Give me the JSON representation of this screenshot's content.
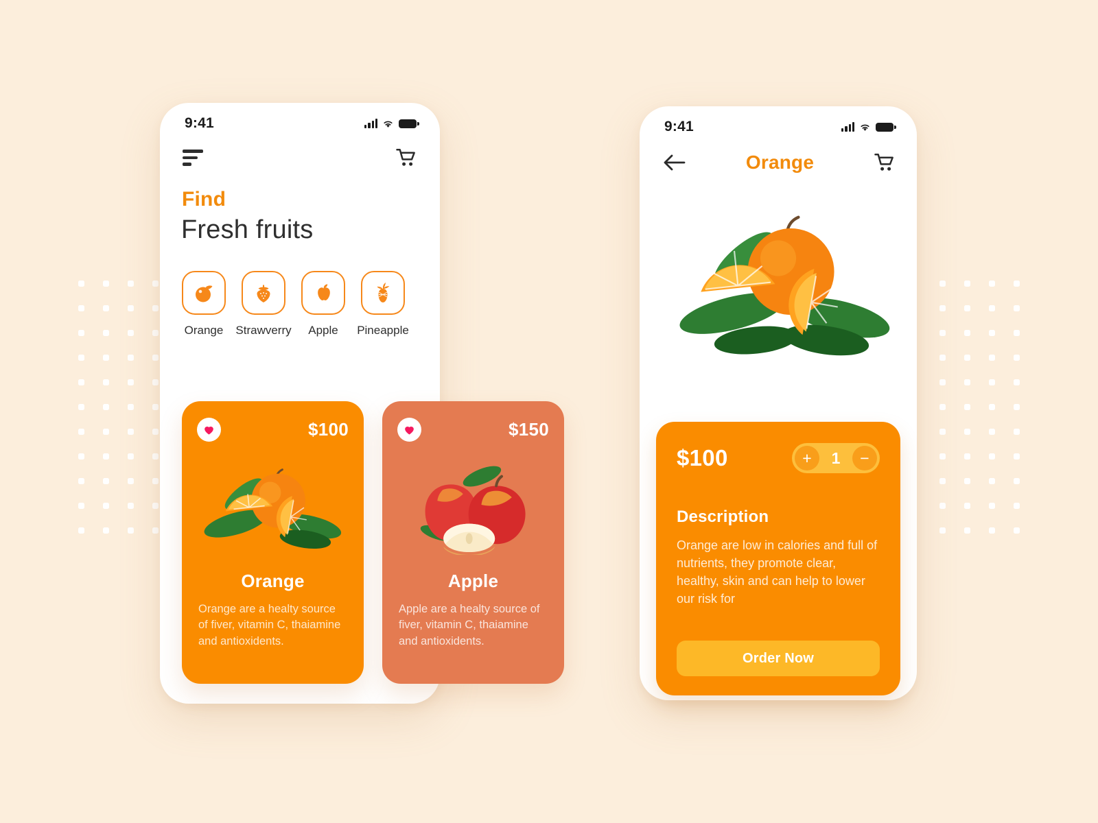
{
  "theme": {
    "page_bg": "#FCEEDC",
    "accent_orange": "#F28B0C",
    "card_orange": "#FA8C00",
    "card_salmon": "#E47B51",
    "amber": "#FDB827",
    "heart_pink": "#F5195E"
  },
  "home": {
    "status": {
      "time": "9:41",
      "signal_icon": "signal-bars-icon",
      "wifi_icon": "wifi-icon",
      "battery_icon": "battery-full-icon"
    },
    "appbar": {
      "menu_icon": "hamburger-menu-icon",
      "cart_icon": "shopping-cart-icon"
    },
    "heading": {
      "eyebrow": "Find",
      "title": "Fresh fruits"
    },
    "categories": [
      {
        "label": "Orange",
        "icon": "orange-fruit-icon"
      },
      {
        "label": "Strawverry",
        "icon": "strawberry-icon"
      },
      {
        "label": "Apple",
        "icon": "apple-fruit-icon"
      },
      {
        "label": "Pineapple",
        "icon": "pineapple-icon"
      }
    ],
    "products": [
      {
        "name": "Orange",
        "price": "$100",
        "description": "Orange are a healty source of fiver, vitamin C, thaiamine and antioxidents.",
        "bg": "#FA8C00",
        "fav_icon": "heart-filled-icon",
        "image": "orange-fruit-photo"
      },
      {
        "name": "Apple",
        "price": "$150",
        "description": "Apple are a healty source of fiver, vitamin C, thaiamine and antioxidents.",
        "bg": "#E47B51",
        "fav_icon": "heart-filled-icon",
        "image": "apple-fruit-photo"
      }
    ]
  },
  "detail": {
    "status": {
      "time": "9:41",
      "signal_icon": "signal-bars-icon",
      "wifi_icon": "wifi-icon",
      "battery_icon": "battery-full-icon"
    },
    "appbar": {
      "back_icon": "arrow-left-icon",
      "title": "Orange",
      "cart_icon": "shopping-cart-icon"
    },
    "hero_image": "orange-fruit-photo",
    "price": "$100",
    "quantity": "1",
    "increment_label": "+",
    "decrement_label": "−",
    "description_heading": "Description",
    "description_body": "Orange are low in calories and full of nutrients, they promote clear, healthy, skin and can help to lower our risk for",
    "order_button": "Order Now"
  }
}
